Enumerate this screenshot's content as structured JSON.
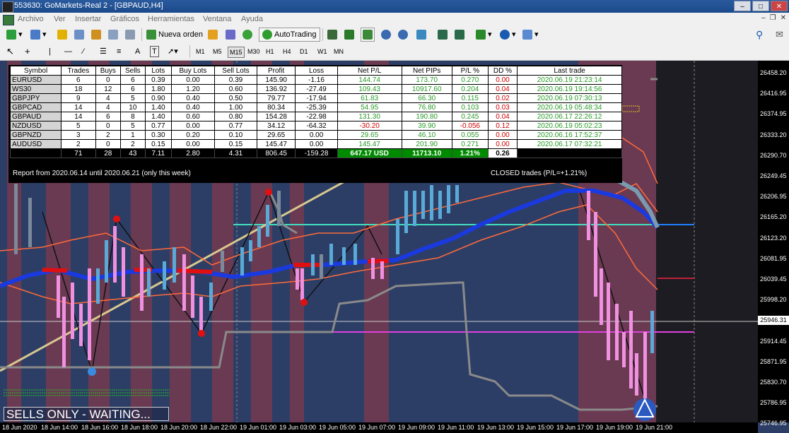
{
  "window": {
    "title": "553630: GoMarkets-Real 2 - [GBPAUD,H4]"
  },
  "menu": [
    "Archivo",
    "Ver",
    "Insertar",
    "Gráficos",
    "Herramientas",
    "Ventana",
    "Ayuda"
  ],
  "toolbar": {
    "new_order": "Nueva orden",
    "autotrading": "AutoTrading"
  },
  "timeframes": [
    "M1",
    "M5",
    "M15",
    "M30",
    "H1",
    "H4",
    "D1",
    "W1",
    "MN"
  ],
  "active_timeframe": "M15",
  "stats": {
    "headers": [
      "Symbol",
      "Trades",
      "Buys",
      "Sells",
      "Lots",
      "Buy Lots",
      "Sell Lots",
      "Profit",
      "Loss",
      "Net P/L",
      "Net PIPs",
      "P/L %",
      "DD %",
      "Last trade"
    ],
    "rows": [
      {
        "symbol": "EURUSD",
        "trades": "6",
        "buys": "0",
        "sells": "6",
        "lots": "0.39",
        "buy_lots": "0.00",
        "sell_lots": "0.39",
        "profit": "145.90",
        "loss": "-1.16",
        "net_pl": "144.74",
        "net_pips": "173.70",
        "pl_pct": "0.270",
        "dd_pct": "0.00",
        "last_trade": "2020.06.19 21:23:14"
      },
      {
        "symbol": "WS30",
        "trades": "18",
        "buys": "12",
        "sells": "6",
        "lots": "1.80",
        "buy_lots": "1.20",
        "sell_lots": "0.60",
        "profit": "136.92",
        "loss": "-27.49",
        "net_pl": "109.43",
        "net_pips": "10917.60",
        "pl_pct": "0.204",
        "dd_pct": "0.04",
        "last_trade": "2020.06.19 19:14:56"
      },
      {
        "symbol": "GBPJPY",
        "trades": "9",
        "buys": "4",
        "sells": "5",
        "lots": "0.90",
        "buy_lots": "0.40",
        "sell_lots": "0.50",
        "profit": "79.77",
        "loss": "-17.94",
        "net_pl": "61.83",
        "net_pips": "66.30",
        "pl_pct": "0.115",
        "dd_pct": "0.02",
        "last_trade": "2020.06.19 07:30:13"
      },
      {
        "symbol": "GBPCAD",
        "trades": "14",
        "buys": "4",
        "sells": "10",
        "lots": "1.40",
        "buy_lots": "0.40",
        "sell_lots": "1.00",
        "profit": "80.34",
        "loss": "-25.39",
        "net_pl": "54.95",
        "net_pips": "76.80",
        "pl_pct": "0.103",
        "dd_pct": "0.03",
        "last_trade": "2020.06.19 05:48:34"
      },
      {
        "symbol": "GBPAUD",
        "trades": "14",
        "buys": "6",
        "sells": "8",
        "lots": "1.40",
        "buy_lots": "0.60",
        "sell_lots": "0.80",
        "profit": "154.28",
        "loss": "-22.98",
        "net_pl": "131.30",
        "net_pips": "190.80",
        "pl_pct": "0.245",
        "dd_pct": "0.04",
        "last_trade": "2020.06.17 22:26:12"
      },
      {
        "symbol": "NZDUSD",
        "trades": "5",
        "buys": "0",
        "sells": "5",
        "lots": "0.77",
        "buy_lots": "0.00",
        "sell_lots": "0.77",
        "profit": "34.12",
        "loss": "-64.32",
        "net_pl": "-30.20",
        "net_pips": "39.90",
        "pl_pct": "-0.056",
        "dd_pct": "0.12",
        "last_trade": "2020.06.19 05:02:23"
      },
      {
        "symbol": "GBPNZD",
        "trades": "3",
        "buys": "2",
        "sells": "1",
        "lots": "0.30",
        "buy_lots": "0.20",
        "sell_lots": "0.10",
        "profit": "29.65",
        "loss": "0.00",
        "net_pl": "29.65",
        "net_pips": "46.10",
        "pl_pct": "0.055",
        "dd_pct": "0.00",
        "last_trade": "2020.06.16 17:52:37"
      },
      {
        "symbol": "AUDUSD",
        "trades": "2",
        "buys": "0",
        "sells": "2",
        "lots": "0.15",
        "buy_lots": "0.00",
        "sell_lots": "0.15",
        "profit": "145.47",
        "loss": "0.00",
        "net_pl": "145.47",
        "net_pips": "201.90",
        "pl_pct": "0.271",
        "dd_pct": "0.00",
        "last_trade": "2020.06.17 07:32:21"
      }
    ],
    "totals": {
      "trades": "71",
      "buys": "28",
      "sells": "43",
      "lots": "7.11",
      "buy_lots": "2.80",
      "sell_lots": "4.31",
      "profit": "806.45",
      "loss": "-159.28",
      "net_pl": "647.17 USD",
      "net_pips": "11713.10",
      "pl_pct": "1.21%",
      "dd_pct": "0.26"
    },
    "report": "Report from 2020.06.14 until 2020.06.21 (only this week)",
    "closed": "CLOSED trades (P/L=+1.21%)"
  },
  "price_axis": [
    "26458.20",
    "26416.95",
    "26374.95",
    "26333.20",
    "26290.70",
    "26249.45",
    "26206.95",
    "26165.20",
    "26123.20",
    "26081.95",
    "26039.45",
    "25998.20",
    "25955.70",
    "25914.45",
    "25871.95",
    "25830.70",
    "25786.95",
    "25746.95"
  ],
  "current_price": "25946.31",
  "time_axis": [
    "18 Jun 2020",
    "18 Jun 14:00",
    "18 Jun 16:00",
    "18 Jun 18:00",
    "18 Jun 20:00",
    "18 Jun 22:00",
    "19 Jun 01:00",
    "19 Jun 03:00",
    "19 Jun 05:00",
    "19 Jun 07:00",
    "19 Jun 09:00",
    "19 Jun 11:00",
    "19 Jun 13:00",
    "19 Jun 15:00",
    "19 Jun 17:00",
    "19 Jun 19:00",
    "19 Jun 21:00"
  ],
  "status_text": "SELLS ONLY - WAITING..."
}
